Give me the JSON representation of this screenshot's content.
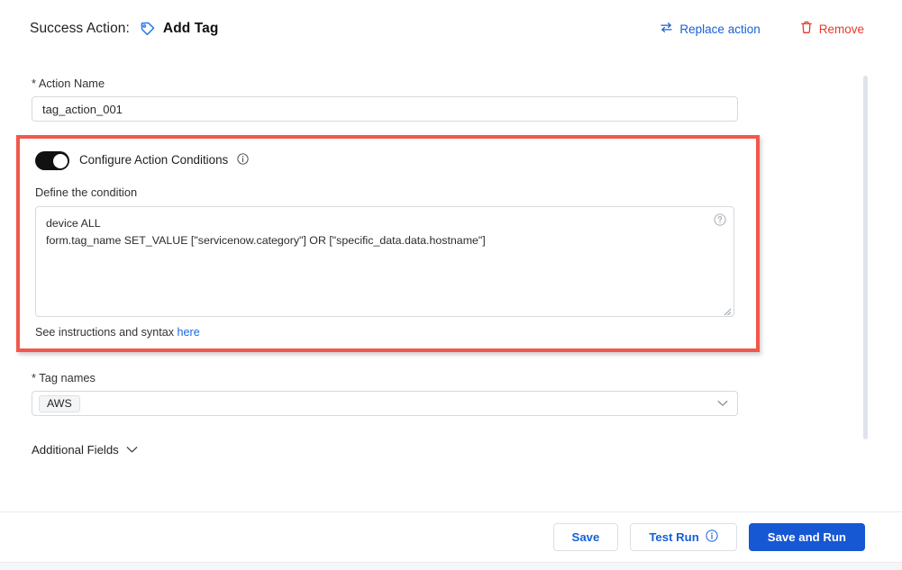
{
  "header": {
    "success_action_label": "Success Action:",
    "action_title": "Add Tag",
    "tag_icon": "tag-icon",
    "replace_action_label": "Replace action",
    "replace_icon": "swap-arrows-icon",
    "remove_label": "Remove",
    "remove_icon": "trash-icon",
    "link_color": "#1661d8",
    "danger_color": "#e8392c"
  },
  "action_name": {
    "label": "* Action Name",
    "value": "tag_action_001",
    "placeholder": "Action Name"
  },
  "conditions": {
    "highlight_color": "#f2584a",
    "toggle_label": "Configure Action Conditions",
    "toggle_state": "on",
    "info_icon": "info-circle-icon",
    "define_label": "Define the condition",
    "condition_text": "device ALL\nform.tag_name SET_VALUE [\"servicenow.category\"] OR [\"specific_data.data.hostname\"]",
    "condition_placeholder": "Define the condition",
    "help_icon": "question-circle-icon",
    "footnote_prefix": "See instructions and syntax ",
    "footnote_link": "here"
  },
  "tag_names": {
    "label": "* Tag names",
    "selected": "AWS",
    "chevron_icon": "chevron-down-icon"
  },
  "additional_fields": {
    "label": "Additional Fields",
    "chevron_icon": "chevron-down-icon"
  },
  "footer": {
    "save_label": "Save",
    "test_run_label": "Test Run",
    "test_run_icon": "info-circle-icon",
    "save_and_run_label": "Save and Run",
    "primary_color": "#1657d4"
  }
}
